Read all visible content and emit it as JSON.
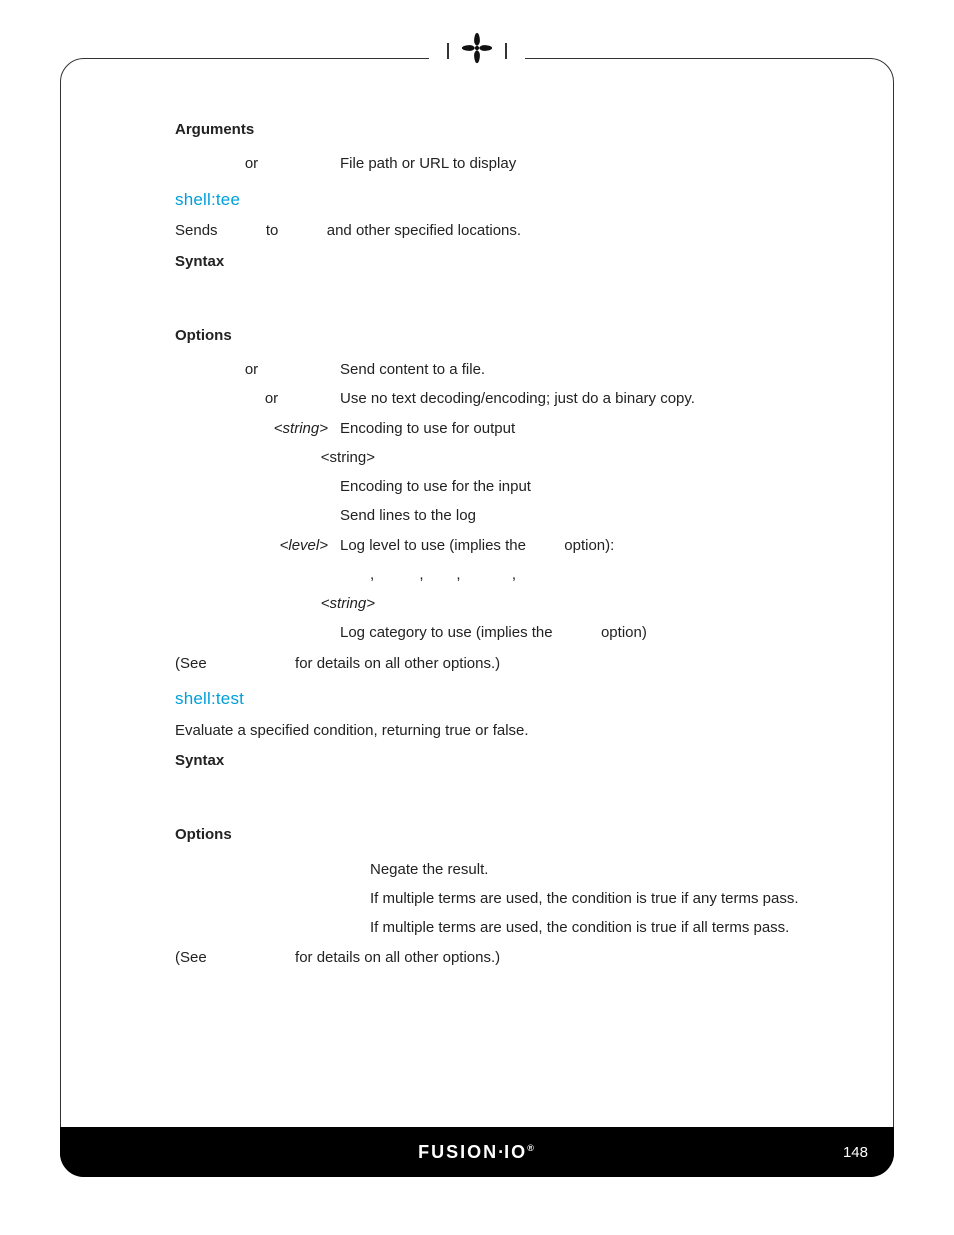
{
  "sections": {
    "arguments_heading": "Arguments",
    "arg_row": {
      "flag": "or",
      "desc": "File path or URL to display"
    },
    "shell_tee": {
      "title": "shell:tee",
      "intro_a": "Sends",
      "intro_b": "to",
      "intro_c": "and other specified locations.",
      "syntax_heading": "Syntax",
      "options_heading": "Options",
      "rows": [
        {
          "flag": "or",
          "desc": "Send content to a file."
        },
        {
          "flag": "or",
          "desc": "Use no text decoding/encoding; just do a binary copy."
        },
        {
          "flag": "<string>",
          "ital": true,
          "desc": "Encoding to use for output"
        },
        {
          "flag": "<string>",
          "desc": ""
        },
        {
          "flag": "",
          "desc": "Encoding to use for the input"
        },
        {
          "flag": "",
          "desc": "Send lines to the log"
        },
        {
          "flag": "<level>",
          "ital": true,
          "desc_a": "Log level to use (implies the",
          "desc_b": "option):"
        },
        {
          "flag": "",
          "desc": ",         ,       ,             ,"
        },
        {
          "flag": "<string>",
          "ital": true,
          "desc": ""
        },
        {
          "flag": "",
          "desc_a": "Log category to use (implies the",
          "desc_b": "option)"
        }
      ],
      "see_a": "(See",
      "see_b": "for details on all other options.)"
    },
    "shell_test": {
      "title": "shell:test",
      "intro": "Evaluate a specified condition, returning true or false.",
      "syntax_heading": "Syntax",
      "options_heading": "Options",
      "rows": [
        {
          "desc": "Negate the result."
        },
        {
          "desc": "If multiple terms are used, the condition is true if any terms pass."
        },
        {
          "desc": "If multiple terms are used, the condition is true if all terms pass."
        }
      ],
      "see_a": "(See",
      "see_b": "for details on all other options.)"
    }
  },
  "footer": {
    "brand": "FUSION-iO",
    "page": "148"
  }
}
